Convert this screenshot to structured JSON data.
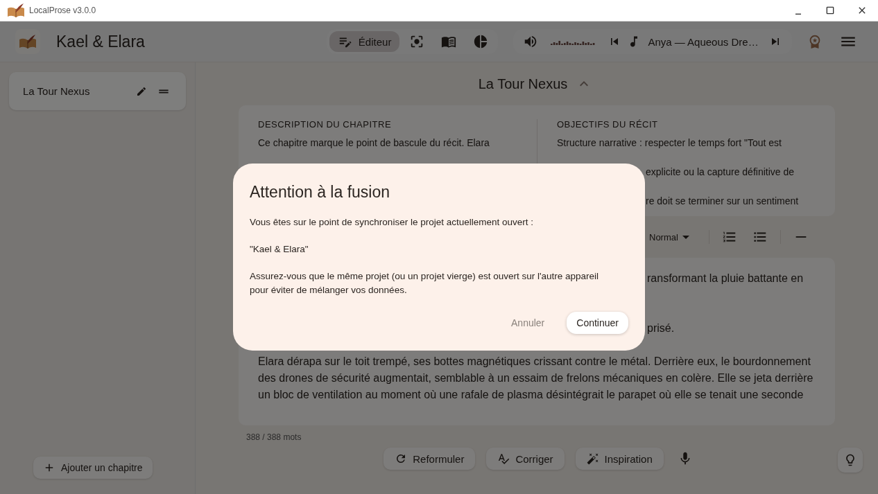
{
  "window": {
    "title": "LocalProse v3.0.0"
  },
  "header": {
    "project_title": "Kael & Elara",
    "view_tabs": [
      {
        "kind": "editor",
        "label": "Éditeur",
        "selected": true
      },
      {
        "kind": "focus",
        "selected": false
      },
      {
        "kind": "book",
        "selected": false
      },
      {
        "kind": "stats",
        "selected": false
      }
    ],
    "player": {
      "track": "Anya — Aqueous Dre…"
    }
  },
  "sidebar": {
    "chapters": [
      {
        "title": "La Tour Nexus"
      }
    ],
    "add_button": "Ajouter un chapitre"
  },
  "chapter": {
    "title": "La Tour Nexus",
    "description": {
      "heading": "DESCRIPTION DU CHAPITRE",
      "lines": [
        "Ce chapitre marque le point de bascule du récit. Elara"
      ]
    },
    "objectives": {
      "heading": "OBJECTIFS DU RÉCIT",
      "lines": [
        "Structure narrative : respecter le temps fort \"Tout est"
      ],
      "fragments": [
        "explicite ou la capture définitive de",
        "re doit se terminer sur un sentiment"
      ]
    }
  },
  "toolbar": {
    "style": "Normal"
  },
  "editor": {
    "fragments": [
      "ransformant la pluie battante en",
      "prisé."
    ],
    "paragraph": "Elara dérapa sur le toit trempé, ses bottes magnétiques crissant contre le métal. Derrière eux, le bourdonnement des drones de sécurité augmentait, semblable à un essaim de frelons mécaniques en colère. Elle se jeta derrière un bloc de ventilation au moment où une rafale de plasma désintégrait le parapet où elle se tenait une seconde"
  },
  "word_count": "388 / 388 mots",
  "actions": [
    {
      "kind": "rephrase",
      "label": "Reformuler"
    },
    {
      "kind": "correct",
      "label": "Corriger"
    },
    {
      "kind": "inspire",
      "label": "Inspiration"
    }
  ],
  "dialog": {
    "title": "Attention à la fusion",
    "paragraphs": [
      "Vous êtes sur le point de synchroniser le projet actuellement ouvert :",
      "\"Kael & Elara\"",
      "Assurez-vous que le même projet (ou un projet vierge) est ouvert sur l'autre appareil pour éviter de mélanger vos données."
    ],
    "buttons": [
      {
        "kind": "cancel",
        "label": "Annuler"
      },
      {
        "kind": "confirm",
        "label": "Continuer"
      }
    ]
  }
}
